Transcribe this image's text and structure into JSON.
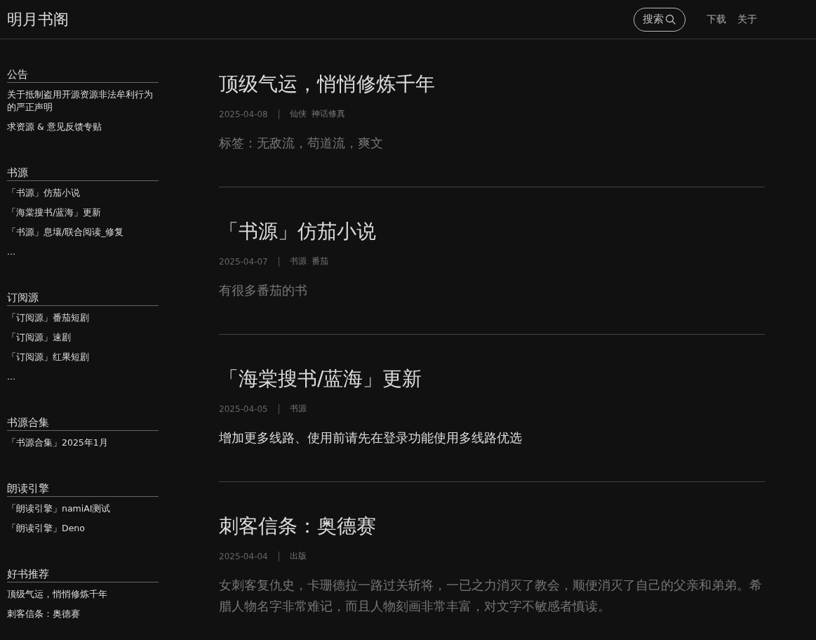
{
  "header": {
    "site_title": "明月书阁",
    "search_button": "搜索",
    "nav": [
      "下载",
      "关于"
    ]
  },
  "sidebar": [
    {
      "title": "公告",
      "items": [
        "关于抵制盗用开源资源非法牟利行为的严正声明",
        "求资源 & 意见反馈专贴"
      ]
    },
    {
      "title": "书源",
      "items": [
        "「书源」仿茄小说",
        "「海棠搜书/蓝海」更新",
        "「书源」息壤/联合阅读_修复",
        "..."
      ]
    },
    {
      "title": "订阅源",
      "items": [
        "「订阅源」番茄短剧",
        "「订阅源」速剧",
        "「订阅源」红果短剧",
        "..."
      ]
    },
    {
      "title": "书源合集",
      "items": [
        "「书源合集」2025年1月"
      ]
    },
    {
      "title": "朗读引擎",
      "items": [
        "「朗读引擎」namiAI测试",
        "「朗读引擎」Deno"
      ]
    },
    {
      "title": "好书推荐",
      "items": [
        "顶级气运，悄悄修炼千年",
        "刺客信条：奥德赛"
      ]
    }
  ],
  "posts": [
    {
      "title": "顶级气运，悄悄修炼千年",
      "date": "2025-04-08",
      "tags": [
        "仙侠",
        "神话修真"
      ],
      "excerpt": "标签：无敌流，苟道流，爽文",
      "kind": "muted"
    },
    {
      "title": "「书源」仿茄小说",
      "date": "2025-04-07",
      "tags": [
        "书源",
        "番茄"
      ],
      "excerpt": "有很多番茄的书",
      "kind": "muted"
    },
    {
      "title": "「海棠搜书/蓝海」更新",
      "date": "2025-04-05",
      "tags": [
        "书源"
      ],
      "excerpt": "增加更多线路、使用前请先在登录功能使用多线路优选",
      "kind": "bright"
    },
    {
      "title": "刺客信条：奥德赛",
      "date": "2025-04-04",
      "tags": [
        "出版"
      ],
      "excerpt": "女刺客复仇史，卡珊德拉一路过关斩将，一已之力消灭了教会，顺便消灭了自己的父亲和弟弟。希腊人物名字非常难记，而且人物刻画非常丰富，对文字不敏感者慎读。",
      "kind": "muted"
    }
  ]
}
